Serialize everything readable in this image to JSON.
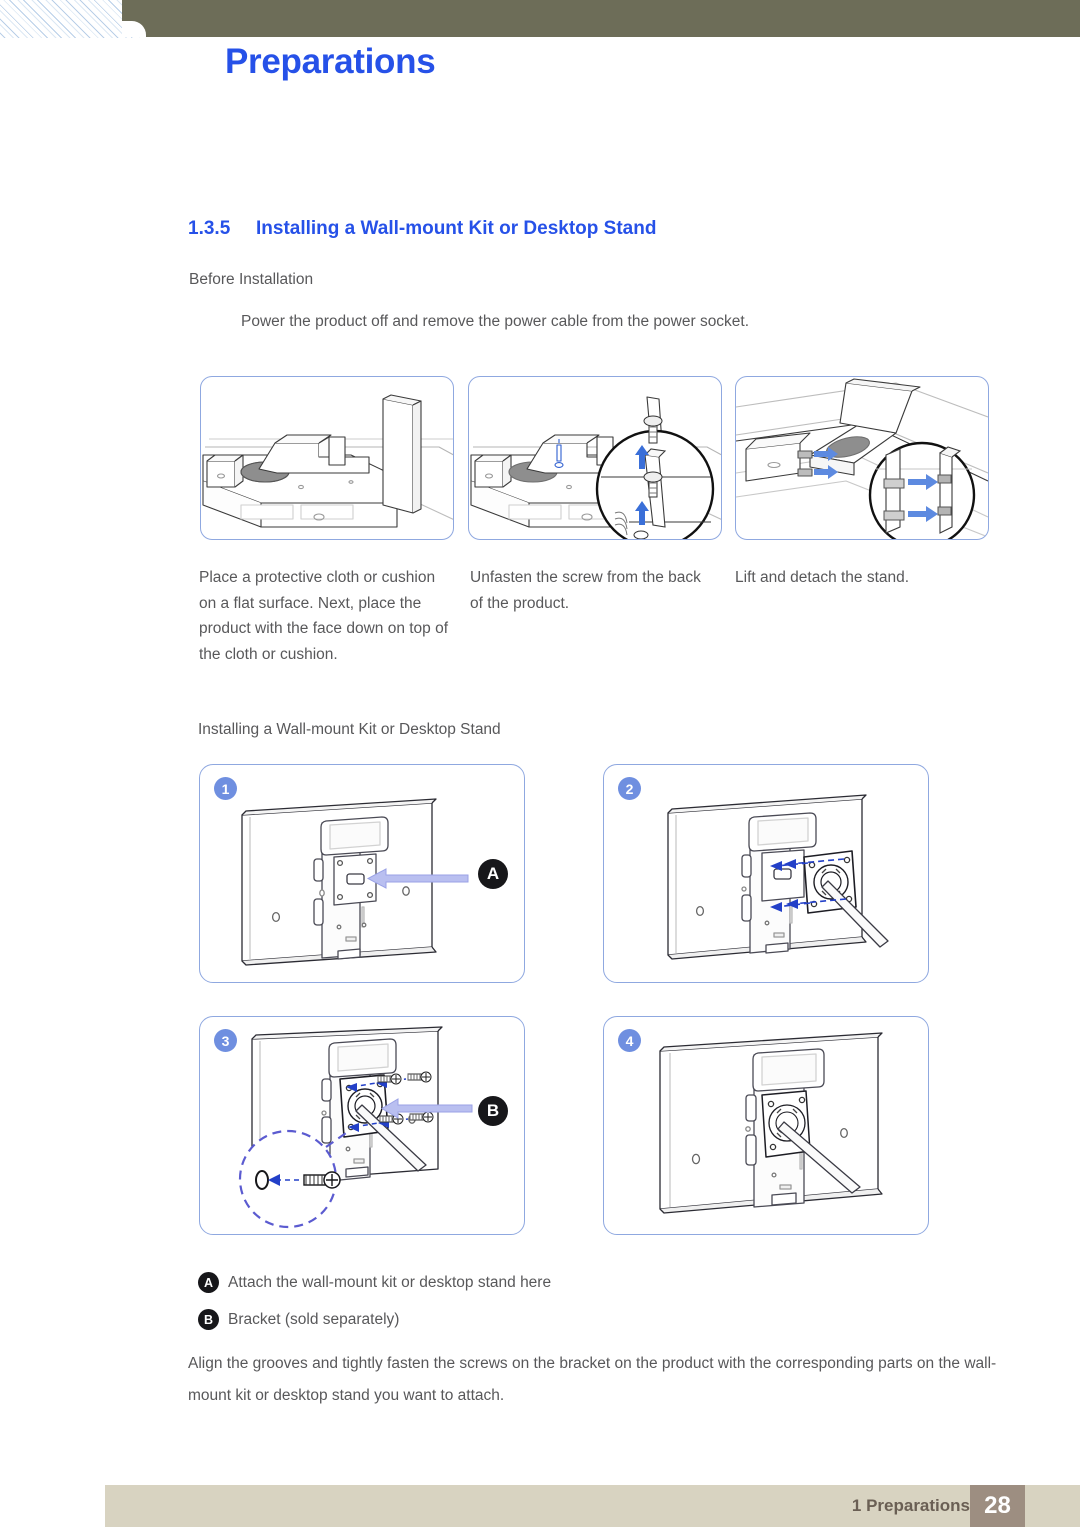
{
  "document": {
    "header_title": "Preparations",
    "section_number": "1.3.5",
    "section_title": "Installing a Wall-mount Kit or Desktop Stand",
    "before_installation_label": "Before Installation",
    "power_note": "Power the product off and remove the power cable from the power socket.",
    "subheading": "Installing a Wall-mount Kit or Desktop Stand",
    "final_note": "Align the grooves and tightly fasten the screws on the bracket on the product with the corresponding parts on the wall-mount kit or desktop stand you want to attach."
  },
  "top_illustrations": [
    {
      "id": "illus-place-cloth",
      "caption": "Place a protective cloth or cushion on a flat surface. Next, place the product with the face down on top of the cloth or cushion.",
      "alt": "Monitor placed face down on a flat cushioned surface"
    },
    {
      "id": "illus-unfasten-screw",
      "caption": "Unfasten the screw from the back of the product.",
      "alt": "Screw being unfastened from the back of the product with magnified detail"
    },
    {
      "id": "illus-detach-stand",
      "caption": "Lift and detach the stand.",
      "alt": "Stand lifted and detached with blue directional arrows"
    }
  ],
  "steps": [
    {
      "number": "1",
      "callout": "A",
      "alt": "Back of monitor with attachment point marked A"
    },
    {
      "number": "2",
      "callout": "",
      "alt": "Bracket aligned to the mounting point with dashed guide arrows"
    },
    {
      "number": "3",
      "callout": "B",
      "alt": "Screws fastened through the bracket, magnified screw detail"
    },
    {
      "number": "4",
      "callout": "",
      "alt": "Bracket fully mounted on the back of the product"
    }
  ],
  "legend": [
    {
      "marker": "A",
      "text": "Attach the wall-mount kit or desktop stand here"
    },
    {
      "marker": "B",
      "text": "Bracket (sold separately)"
    }
  ],
  "footer": {
    "chapter": "1 Preparations",
    "page_number": "28"
  },
  "colors": {
    "heading_blue": "#2651e8",
    "header_olive": "#6d6d58",
    "panel_border": "#8fa8e0",
    "badge_blue": "#6f8fe0",
    "callout_black": "#17171a",
    "footer_beige": "#d8d3c1",
    "footer_page_brown": "#9d8e81",
    "body_text": "#58585a"
  }
}
